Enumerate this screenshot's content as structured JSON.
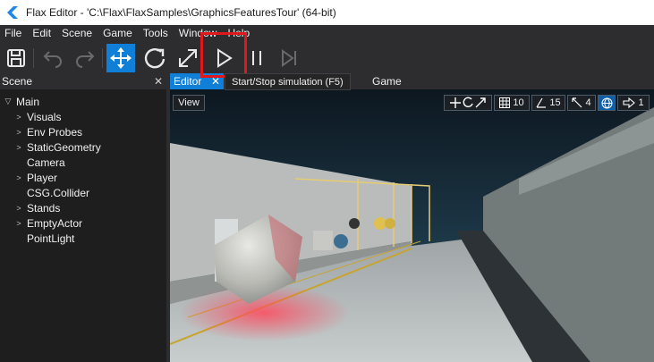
{
  "window": {
    "title": "Flax Editor - 'C:\\Flax\\FlaxSamples\\GraphicsFeaturesTour' (64-bit)"
  },
  "menu": [
    "File",
    "Edit",
    "Scene",
    "Game",
    "Tools",
    "Window",
    "Help"
  ],
  "toolbar": {
    "buttons": [
      {
        "name": "save-icon"
      },
      {
        "name": "undo-icon"
      },
      {
        "name": "redo-icon"
      },
      {
        "name": "translate-icon",
        "active": true
      },
      {
        "name": "rotate-icon"
      },
      {
        "name": "scale-icon"
      },
      {
        "name": "play-icon"
      },
      {
        "name": "pause-icon"
      },
      {
        "name": "step-icon"
      }
    ],
    "tooltip": "Start/Stop simulation (F5)"
  },
  "scene_panel": {
    "title": "Scene",
    "close": "✕",
    "root": "Main",
    "items": [
      {
        "label": "Visuals",
        "expandable": true
      },
      {
        "label": "Env Probes",
        "expandable": true
      },
      {
        "label": "StaticGeometry",
        "expandable": true
      },
      {
        "label": "Camera",
        "expandable": false
      },
      {
        "label": "Player",
        "expandable": true
      },
      {
        "label": "CSG.Collider",
        "expandable": false
      },
      {
        "label": "Stands",
        "expandable": true
      },
      {
        "label": "EmptyActor",
        "expandable": true
      },
      {
        "label": "PointLight",
        "expandable": false
      }
    ]
  },
  "tabs": {
    "editor": "Editor",
    "editor_close": "✕",
    "game": "Game"
  },
  "viewport": {
    "view_button": "View",
    "grid_value": "10",
    "angle_value": "15",
    "scale_value": "4",
    "camera_speed": "1"
  },
  "colors": {
    "accent": "#0f7fd8",
    "highlight": "#e0181c"
  }
}
